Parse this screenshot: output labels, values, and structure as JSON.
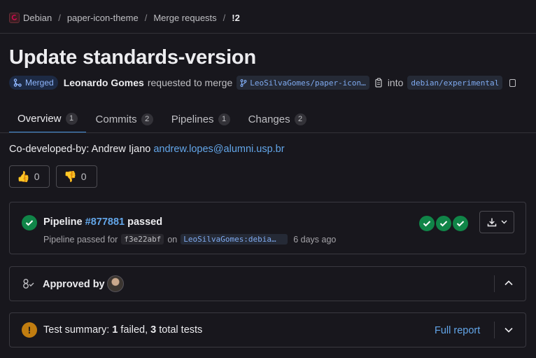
{
  "breadcrumb": {
    "group": "Debian",
    "project": "paper-icon-theme",
    "section": "Merge requests",
    "current": "!2",
    "separator": "/"
  },
  "mr": {
    "title": "Update standards-version",
    "status": "Merged",
    "author": "Leonardo Gomes",
    "action": "requested to merge",
    "source_branch": "LeoSilvaGomes/paper-icon…",
    "into": "into",
    "target_branch": "debian/experimental"
  },
  "tabs": [
    {
      "label": "Overview",
      "count": "1"
    },
    {
      "label": "Commits",
      "count": "2"
    },
    {
      "label": "Pipelines",
      "count": "1"
    },
    {
      "label": "Changes",
      "count": "2"
    }
  ],
  "description": {
    "text": "Co-developed-by: Andrew Ijano ",
    "email": "andrew.lopes@alumni.usp.br"
  },
  "reactions": {
    "thumbsup": {
      "glyph": "👍",
      "count": "0"
    },
    "thumbsdown": {
      "glyph": "👎",
      "count": "0"
    }
  },
  "pipeline": {
    "label": "Pipeline",
    "id": "#877881",
    "status": "passed",
    "sub_prefix": "Pipeline passed for",
    "sha": "f3e22abf",
    "on": "on",
    "branch": "LeoSilvaGomes:debia…",
    "time": "6 days ago"
  },
  "approvals": {
    "label": "Approved by"
  },
  "tests": {
    "label": "Test summary: ",
    "failed": "1",
    "failed_label": " failed, ",
    "total": "3",
    "total_label": " total tests",
    "report": "Full report"
  },
  "colors": {
    "accent": "#428fdc",
    "link": "#63a6e9",
    "success": "#108548",
    "warning": "#c17d10",
    "background": "#18171d"
  }
}
